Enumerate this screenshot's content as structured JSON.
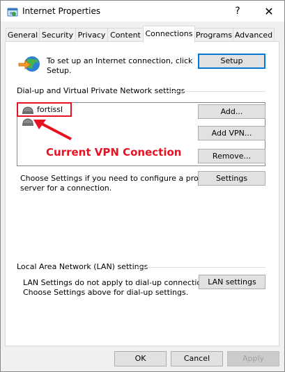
{
  "window": {
    "title": "Internet Properties",
    "help_glyph": "?",
    "close_glyph": "✕"
  },
  "tabs": [
    {
      "label": "General"
    },
    {
      "label": "Security"
    },
    {
      "label": "Privacy"
    },
    {
      "label": "Content"
    },
    {
      "label": "Connections"
    },
    {
      "label": "Programs"
    },
    {
      "label": "Advanced"
    }
  ],
  "active_tab": "Connections",
  "setup_section": {
    "description": "To set up an Internet connection, click Setup.",
    "line1": "To set up an Internet connection, click",
    "line2": "Setup.",
    "setup_button": "Setup"
  },
  "dialup_section": {
    "heading": "Dial-up and Virtual Private Network settings",
    "connections": [
      {
        "name": "fortissl"
      },
      {
        "name": ""
      }
    ],
    "add_button": "Add...",
    "add_vpn_button": "Add VPN...",
    "remove_button": "Remove...",
    "settings_button": "Settings",
    "proxy_line1": "Choose Settings if you need to configure a proxy",
    "proxy_line2": "server for a connection.",
    "annotation": "Current VPN Conection",
    "annotation_color": "#e81123"
  },
  "lan_section": {
    "heading": "Local Area Network (LAN) settings",
    "line1": "LAN Settings do not apply to dial-up connections.",
    "line2": "Choose Settings above for dial-up settings.",
    "lan_button": "LAN settings"
  },
  "footer": {
    "ok": "OK",
    "cancel": "Cancel",
    "apply": "Apply"
  },
  "colors": {
    "accent": "#0078d7",
    "annotation": "#e81123",
    "window_bg": "#f0f0f0",
    "panel_bg": "#ffffff"
  }
}
